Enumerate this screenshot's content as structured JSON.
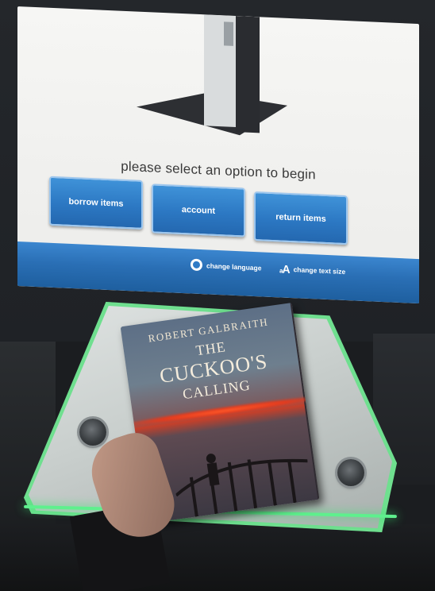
{
  "screen": {
    "prompt": "please select an option to begin",
    "options": [
      {
        "label": "borrow items"
      },
      {
        "label": "account"
      },
      {
        "label": "return items"
      }
    ],
    "bottom_bar": {
      "change_language": "change language",
      "change_text_size": "change text size",
      "text_size_glyph_small": "a",
      "text_size_glyph_large": "A"
    },
    "accent_color": "#2c78c3"
  },
  "book": {
    "author": "ROBERT GALBRAITH",
    "title_line1": "THE",
    "title_line2": "CUCKOO'S",
    "title_line3": "CALLING"
  },
  "colors": {
    "glow": "#5ef08d",
    "bezel": "#24272b"
  }
}
